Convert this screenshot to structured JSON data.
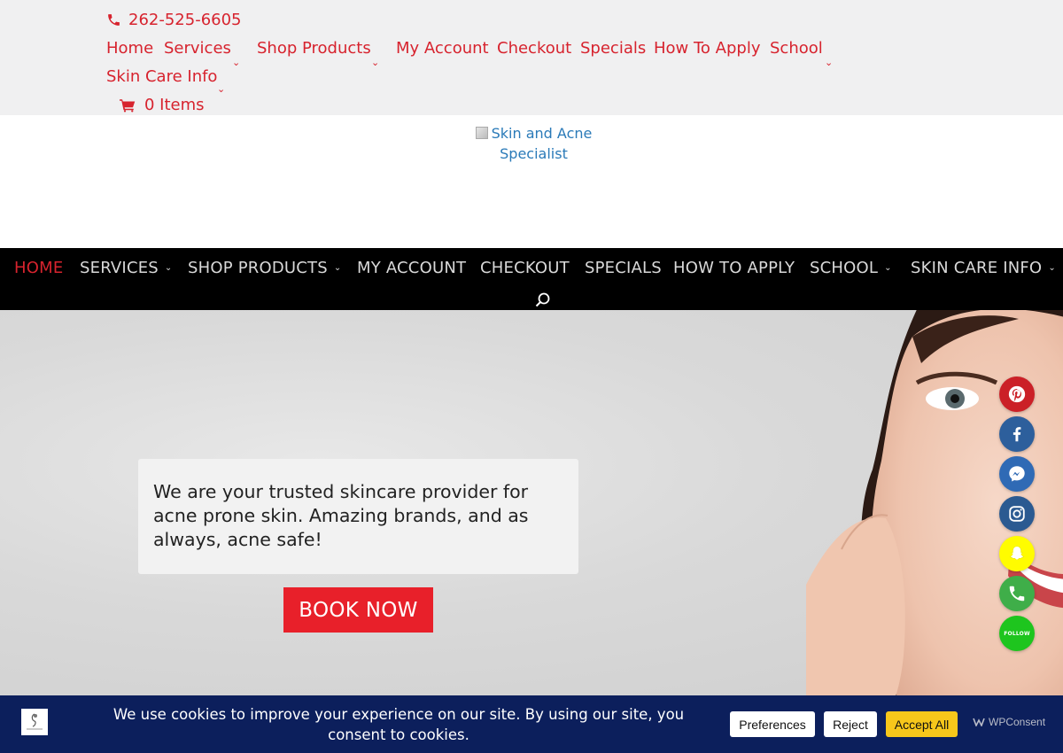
{
  "topbar": {
    "phone": "262-525-6605",
    "nav": [
      "Home",
      "Services",
      "Shop Products",
      "My Account",
      "Checkout",
      "Specials",
      "How To Apply",
      "School",
      "Skin Care Info"
    ],
    "cart_label": "0 Items"
  },
  "logo": {
    "alt": "Skin and Acne Specialist"
  },
  "mainnav": {
    "items": [
      "HOME",
      "SERVICES",
      "SHOP PRODUCTS",
      "MY ACCOUNT",
      "CHECKOUT",
      "SPECIALS",
      "HOW TO APPLY",
      "SCHOOL",
      "SKIN CARE INFO"
    ],
    "active": "HOME"
  },
  "hero": {
    "text": "We are your trusted skincare provider for acne prone skin. Amazing brands, and as always, acne safe!",
    "button": "BOOK NOW"
  },
  "social": {
    "items": [
      {
        "name": "pinterest",
        "color": "#cb2027"
      },
      {
        "name": "facebook",
        "color": "#2d5f9c"
      },
      {
        "name": "messenger",
        "color": "#2f6ab5"
      },
      {
        "name": "instagram",
        "color": "#2b5a91"
      },
      {
        "name": "snapchat",
        "color": "#fffc00"
      },
      {
        "name": "phone",
        "color": "#3fae49"
      },
      {
        "name": "follow",
        "color": "#1ec51e"
      }
    ],
    "follow_label": "FOLLOW"
  },
  "cookie": {
    "text": "We use cookies to improve your experience on our site. By using our site, you consent to cookies.",
    "preferences": "Preferences",
    "reject": "Reject",
    "accept": "Accept All",
    "brand": "WPConsent"
  },
  "colors": {
    "accent": "#d7232e",
    "nav_bg": "#000000",
    "cookie_bg": "#0c1f5c",
    "accept": "#f7c71b"
  }
}
